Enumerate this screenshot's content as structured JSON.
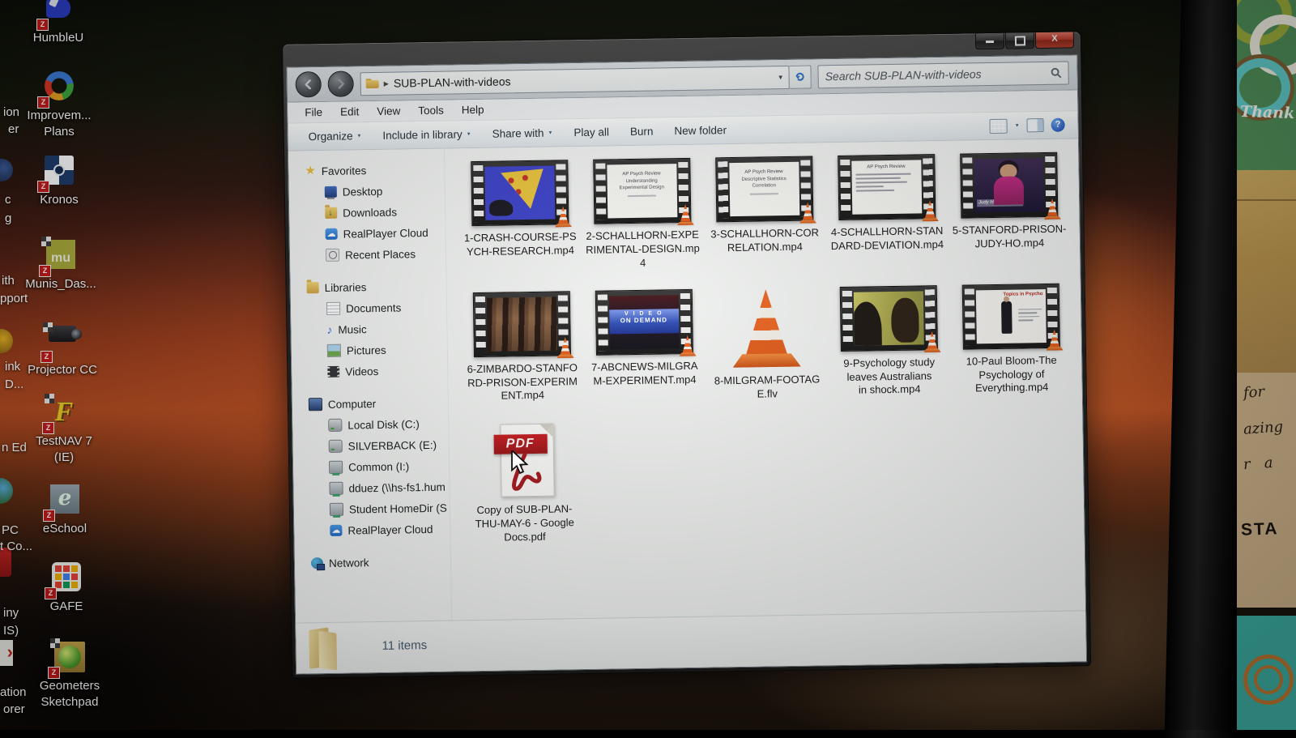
{
  "desktop": {
    "icons": [
      {
        "label": "HumbleU"
      },
      {
        "label": "Improvem...",
        "label2": "Plans"
      },
      {
        "label": "Kronos"
      },
      {
        "label": "Munis_Das..."
      },
      {
        "label": "Projector CC"
      },
      {
        "label": "TestNAV 7",
        "label2": "(IE)"
      },
      {
        "label": "eSchool"
      },
      {
        "label": "GAFE"
      },
      {
        "label": "Geometers",
        "label2": "Sketchpad"
      }
    ],
    "edge_fragments": [
      "ion",
      "er",
      "c",
      "g",
      "ith",
      "pport",
      "ink",
      "D...",
      "n Ed",
      "PC",
      "t Co...",
      "iny",
      "IS)",
      "ation",
      "orer"
    ]
  },
  "window": {
    "address": {
      "path": "SUB-PLAN-with-videos"
    },
    "search": {
      "placeholder": "Search SUB-PLAN-with-videos"
    },
    "menu": {
      "items": [
        "File",
        "Edit",
        "View",
        "Tools",
        "Help"
      ]
    },
    "toolbar": {
      "organize": "Organize",
      "include": "Include in library",
      "share": "Share with",
      "play": "Play all",
      "burn": "Burn",
      "new_folder": "New folder"
    },
    "sidebar": {
      "sections": [
        {
          "label": "Favorites",
          "items": [
            "Desktop",
            "Downloads",
            "RealPlayer Cloud",
            "Recent Places"
          ]
        },
        {
          "label": "Libraries",
          "items": [
            "Documents",
            "Music",
            "Pictures",
            "Videos"
          ]
        },
        {
          "label": "Computer",
          "items": [
            "Local Disk (C:)",
            "SILVERBACK (E:)",
            "Common (I:)",
            "dduez (\\\\hs-fs1.hum",
            "Student HomeDir (S",
            "RealPlayer Cloud"
          ]
        },
        {
          "label": "Network",
          "items": []
        }
      ]
    },
    "files": [
      {
        "name": "1-CRASH-COURSE-PSYCH-RESEARCH.mp4"
      },
      {
        "name": "2-SCHALLHORN-EXPERIMENTAL-DESIGN.mp4",
        "lines": [
          "AP Psych Review",
          "Understanding",
          "Experimental Design"
        ]
      },
      {
        "name": "3-SCHALLHORN-CORRELATION.mp4",
        "lines": [
          "AP Psych Review",
          "Descriptive Statistics Correlation"
        ]
      },
      {
        "name": "4-SCHALLHORN-STANDARD-DEVIATION.mp4",
        "lines": [
          "AP Psych Review"
        ]
      },
      {
        "name": "5-STANFORD-PRISON-JUDY-HO.mp4",
        "caption": "Judy Ho Ph.D"
      },
      {
        "name": "6-ZIMBARDO-STANFORD-PRISON-EXPERIMENT.mp4"
      },
      {
        "name": "7-ABCNEWS-MILGRAM-EXPERIMENT.mp4",
        "lines": [
          "V I D E O",
          "ON DEMAND"
        ]
      },
      {
        "name": "8-MILGRAM-FOOTAGE.flv"
      },
      {
        "name": "9-Psychology study leaves Australians in shock.mp4"
      },
      {
        "name": "10-Paul Bloom-The Psychology of Everything.mp4",
        "slide_title": "Topics in Psycho"
      },
      {
        "name": "Copy of SUB-PLAN-THU-MAY-6 - Google Docs.pdf",
        "badge": "PDF"
      }
    ],
    "status": {
      "count": "11 items"
    }
  },
  "surroundings": {
    "card_word": "Thank",
    "script_lines": [
      "for",
      "azing",
      "r   a"
    ],
    "caps_word": "STA"
  }
}
